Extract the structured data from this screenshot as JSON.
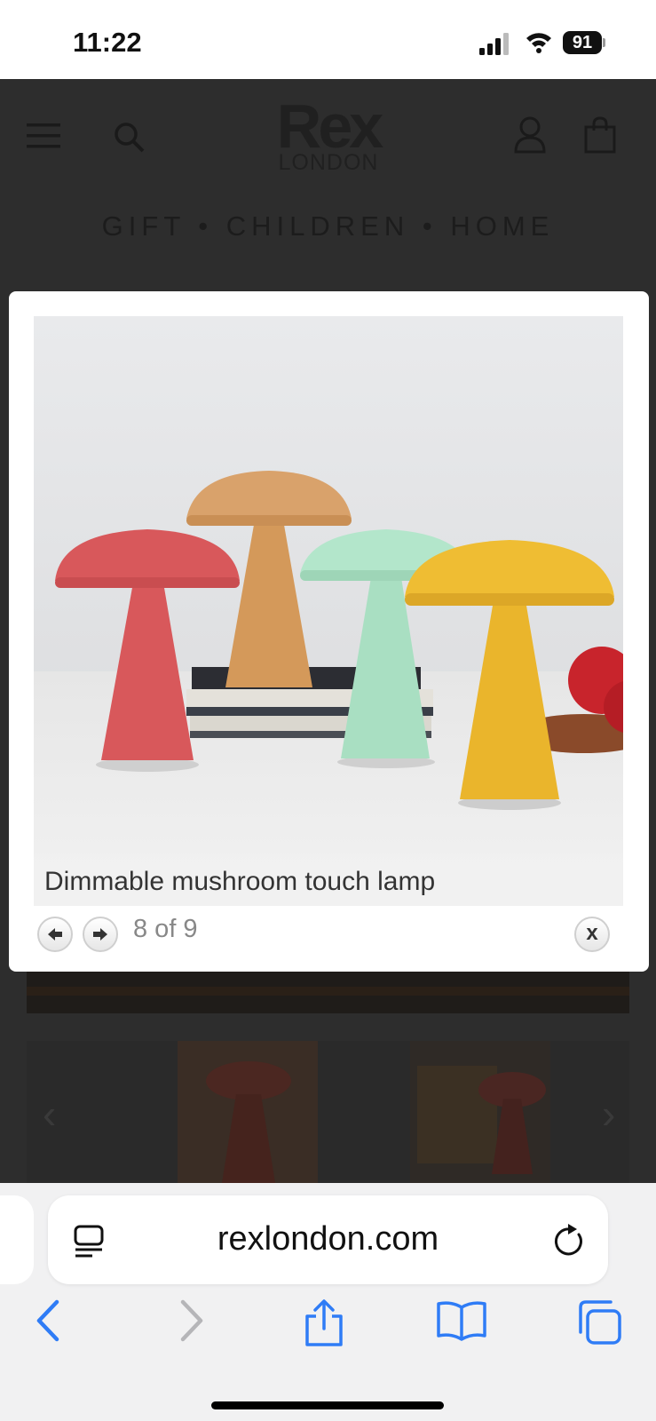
{
  "status_bar": {
    "time": "11:22",
    "battery": "91"
  },
  "site": {
    "logo_word": "Rex",
    "logo_sub": "LONDON",
    "nav": "GIFT • CHILDREN • HOME"
  },
  "lightbox": {
    "caption": "Dimmable mushroom touch lamp",
    "counter": "8 of 9",
    "close_label": "x"
  },
  "safari": {
    "url": "rexlondon.com"
  },
  "colors": {
    "safari_blue": "#2f7cf6",
    "lamp_red": "#d8585b",
    "lamp_tan": "#d4995a",
    "lamp_mint": "#a9dfc2",
    "lamp_yellow": "#eab52c"
  }
}
